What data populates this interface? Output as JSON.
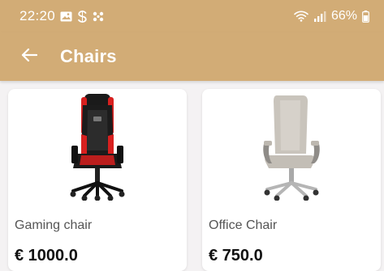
{
  "status_bar": {
    "time": "22:20",
    "battery": "66%"
  },
  "app_bar": {
    "title": "Chairs"
  },
  "products": [
    {
      "name": "Gaming chair",
      "price": "€ 1000.0"
    },
    {
      "name": "Office Chair",
      "price": "€ 750.0"
    }
  ],
  "colors": {
    "app_bar": "#D2AC76",
    "background": "#F4F2F3",
    "gaming_accent": "#D8201F"
  },
  "icons": {
    "status_left": [
      "gallery-icon",
      "s-app-icon",
      "dots-grid-icon"
    ],
    "status_right": [
      "wifi-icon",
      "signal-icon",
      "battery-icon"
    ],
    "app_bar": "arrow-left-icon"
  }
}
